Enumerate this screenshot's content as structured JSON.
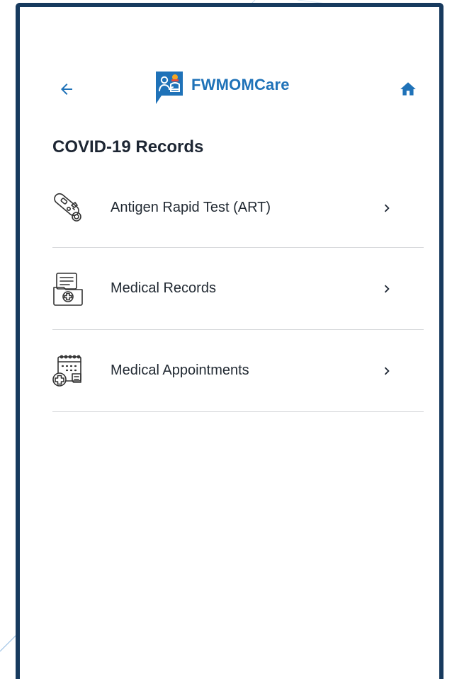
{
  "app": {
    "brand_name": "FWMOMCare",
    "brand_color": "#1f72b8",
    "frame_color": "#173a5e"
  },
  "header": {
    "back_icon": "arrow-left-icon",
    "home_icon": "home-icon",
    "logo_icon": "fwmomcare-logo-icon"
  },
  "page": {
    "title": "COVID-19 Records"
  },
  "menu": {
    "items": [
      {
        "label": "Antigen Rapid Test (ART)",
        "icon": "antigen-test-kit-icon"
      },
      {
        "label": "Medical Records",
        "icon": "medical-records-icon"
      },
      {
        "label": "Medical Appointments",
        "icon": "medical-appointment-calendar-icon"
      }
    ],
    "chevron_icon": "chevron-right-icon"
  }
}
